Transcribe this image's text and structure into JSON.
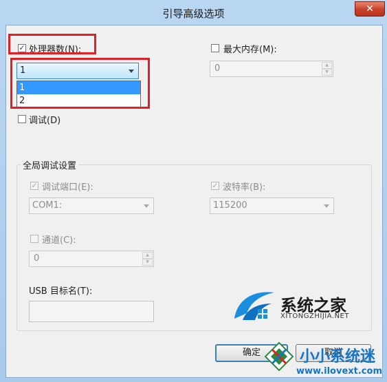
{
  "window": {
    "title": "引导高级选项",
    "close_glyph": "✕"
  },
  "processors": {
    "label": "处理器数(N):",
    "checked": true,
    "selected": "1",
    "options": [
      "1",
      "2"
    ],
    "highlighted_index": 0
  },
  "max_memory": {
    "label": "最大内存(M):",
    "checked": false,
    "value": "0"
  },
  "debug": {
    "label": "调试(D)",
    "checked": false
  },
  "global_debug": {
    "group_label": "全局调试设置",
    "debug_port": {
      "label": "调试端口(E):",
      "checked": true,
      "value": "COM1:"
    },
    "baud_rate": {
      "label": "波特率(B):",
      "checked": true,
      "value": "115200"
    },
    "channel": {
      "label": "通道(C):",
      "checked": false,
      "value": "0"
    },
    "usb_target": {
      "label": "USB 目标名(T):",
      "value": ""
    }
  },
  "buttons": {
    "ok": "确定",
    "cancel": "取消"
  },
  "watermark": {
    "brand_cn": "系统之家",
    "brand_en": "XITONGZHIJIA.NET",
    "brand2_cn": "小小系统迷",
    "brand2_url": "www.ilovext.com"
  },
  "colors": {
    "highlight": "#e21f26",
    "selection": "#3399ff",
    "brand": "#1574c4"
  },
  "icons": {
    "check": "check-icon",
    "dropdown": "chevron-down-icon",
    "spin_up": "arrow-up-icon",
    "spin_down": "arrow-down-icon"
  }
}
